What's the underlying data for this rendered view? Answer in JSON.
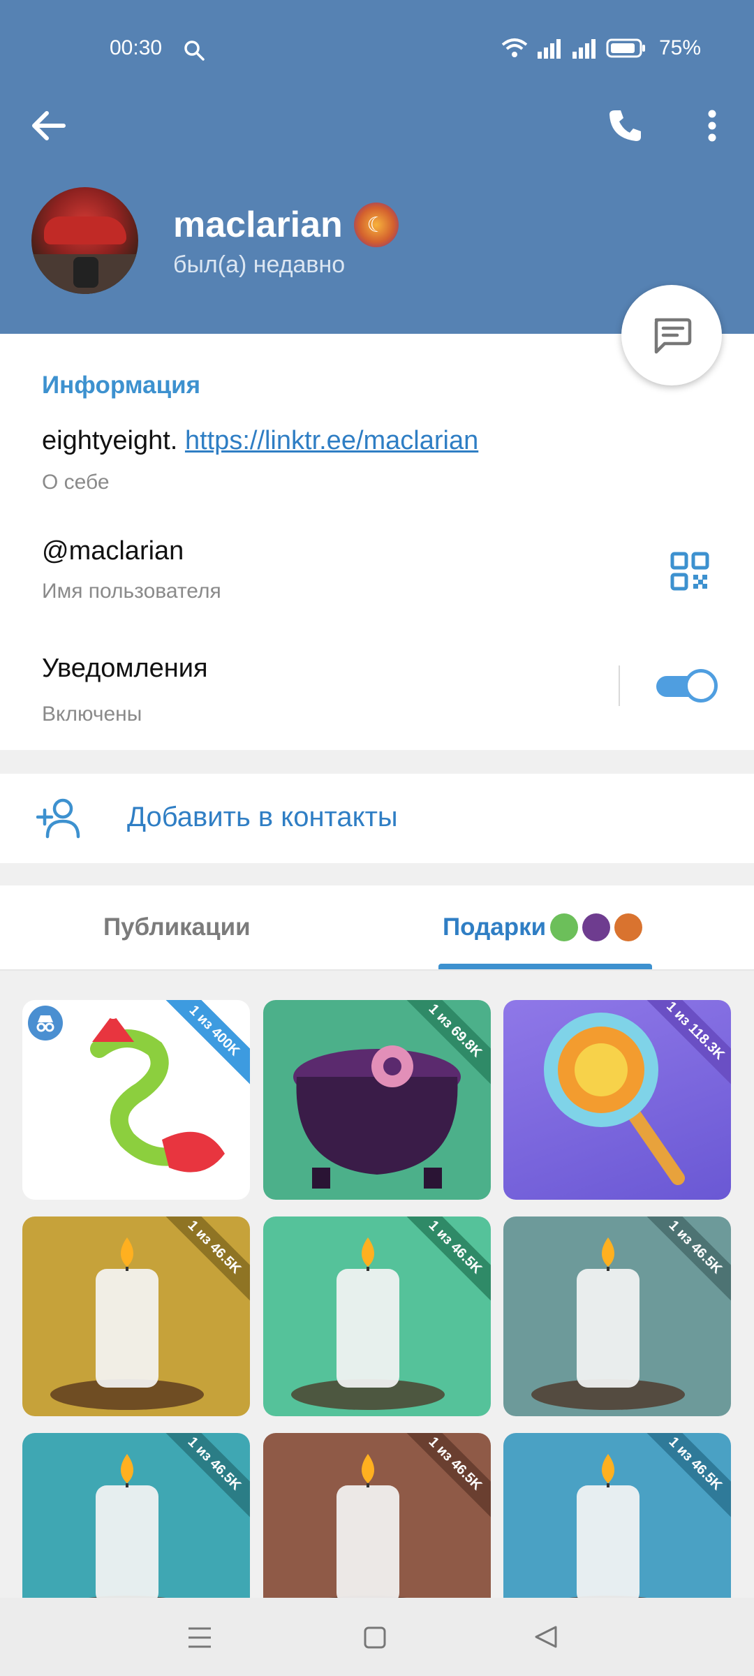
{
  "status_bar": {
    "time": "00:30",
    "battery": "75%"
  },
  "profile": {
    "name": "maclarian",
    "last_seen": "был(а) недавно"
  },
  "info": {
    "section_title": "Информация",
    "bio_text": "eightyeight.",
    "bio_link": "https://linktr.ee/maclarian",
    "bio_caption": "О себе",
    "username": "@maclarian",
    "username_caption": "Имя пользователя",
    "notifications_title": "Уведомления",
    "notifications_status": "Включены"
  },
  "actions": {
    "add_contact": "Добавить в контакты"
  },
  "tabs": {
    "publications": "Публикации",
    "gifts": "Подарки"
  },
  "gifts": [
    {
      "ribbon": "1 из 400K",
      "bg": "#ffffff",
      "ribbon_color": "#3d9be0",
      "icon": "snake-gift"
    },
    {
      "ribbon": "1 из 69.8K",
      "bg": "#4cb08a",
      "ribbon_color": "#2f8a67",
      "icon": "cauldron-gift"
    },
    {
      "ribbon": "1 из 118.3K",
      "bg": "#8a6fe0",
      "ribbon_color": "#6a4fc4",
      "icon": "lollipop-gift"
    },
    {
      "ribbon": "1 из 46.5K",
      "bg": "#c6a23a",
      "ribbon_color": "#8f7424",
      "icon": "candle-gift"
    },
    {
      "ribbon": "1 из 46.5K",
      "bg": "#55c29a",
      "ribbon_color": "#2f8a67",
      "icon": "candle-gift"
    },
    {
      "ribbon": "1 из 46.5K",
      "bg": "#6d9a9a",
      "ribbon_color": "#4d7373",
      "icon": "candle-gift"
    },
    {
      "ribbon": "1 из 46.5K",
      "bg": "#3fa7b3",
      "ribbon_color": "#2b7d86",
      "icon": "candle-gift"
    },
    {
      "ribbon": "1 из 46.5K",
      "bg": "#8f5a47",
      "ribbon_color": "#6a3f30",
      "icon": "candle-gift"
    },
    {
      "ribbon": "1 из 46.5K",
      "bg": "#4aa1c4",
      "ribbon_color": "#2f7a99",
      "icon": "candle-gift"
    }
  ]
}
